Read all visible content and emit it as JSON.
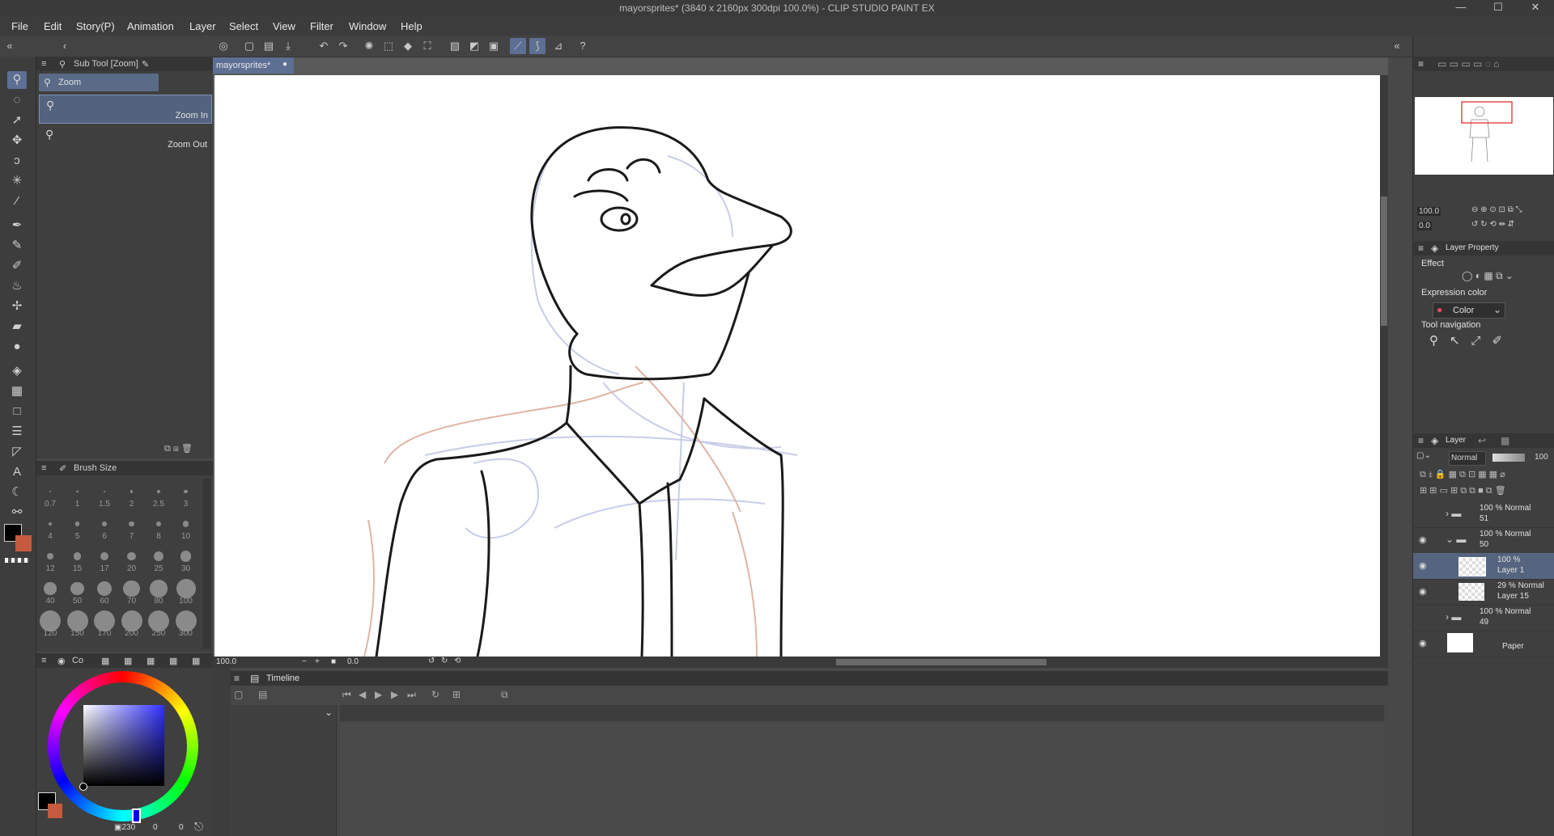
{
  "window": {
    "title": "mayorsprites* (3840 x 2160px 300dpi 100.0%) - CLIP STUDIO PAINT EX",
    "minimize": "—",
    "maximize": "☐",
    "close": "✕"
  },
  "menu": [
    "File",
    "Edit",
    "Story(P)",
    "Animation",
    "Layer",
    "Select",
    "View",
    "Filter",
    "Window",
    "Help"
  ],
  "subtool": {
    "title": "Sub Tool [Zoom]",
    "group": "Zoom",
    "items": [
      "Zoom In",
      "Zoom Out"
    ]
  },
  "brush_size": {
    "title": "Brush Size",
    "sizes": [
      "0.7",
      "1",
      "1.5",
      "2",
      "2.5",
      "3",
      "4",
      "5",
      "6",
      "7",
      "8",
      "10",
      "12",
      "15",
      "17",
      "20",
      "25",
      "30",
      "40",
      "50",
      "60",
      "70",
      "80",
      "100",
      "120",
      "150",
      "170",
      "200",
      "250",
      "300"
    ]
  },
  "color_panel": {
    "tab": "Co",
    "values": [
      "230",
      "0",
      "0"
    ],
    "main_color": "#000000",
    "sub_color": "#c45b3e"
  },
  "document": {
    "tab": "mayorsprites*"
  },
  "canvas_status": {
    "zoom": "100.0",
    "angle": "0.0"
  },
  "timeline": {
    "title": "Timeline"
  },
  "navigator": {
    "zoom": "100.0",
    "angle": "0.0"
  },
  "layer_property": {
    "title": "Layer Property",
    "effect_label": "Effect",
    "expression_label": "Expression color",
    "expression_value": "Color",
    "toolnav_label": "Tool navigation"
  },
  "layer_panel": {
    "title": "Layer",
    "blend": "Normal",
    "opacity": "100",
    "layers": [
      {
        "opacity": "100 % Normal",
        "name": "51",
        "type": "folder",
        "selected": false
      },
      {
        "opacity": "100 % Normal",
        "name": "50",
        "type": "folder-open",
        "selected": false
      },
      {
        "opacity": "100 %",
        "name": "Layer 1",
        "type": "raster",
        "selected": true
      },
      {
        "opacity": "29 % Normal",
        "name": "Layer 15",
        "type": "raster",
        "selected": false
      },
      {
        "opacity": "100 % Normal",
        "name": "49",
        "type": "folder",
        "selected": false
      },
      {
        "opacity": "",
        "name": "Paper",
        "type": "paper",
        "selected": false
      }
    ]
  }
}
